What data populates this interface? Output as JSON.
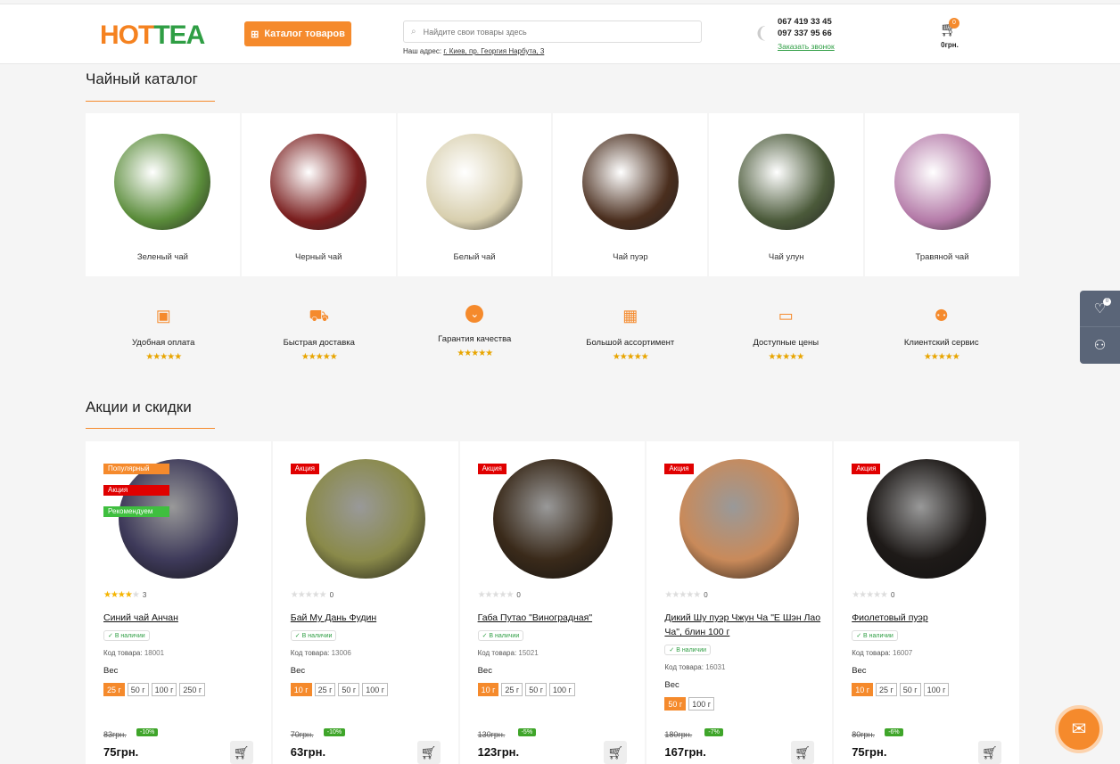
{
  "header": {
    "logo_hot": "HOT",
    "logo_tea": "TEA",
    "catalog_button": "Каталог товаров",
    "search_placeholder": "Найдите свои товары здесь",
    "address_label": "Наш адрес:",
    "address_value": "г. Киев, пр. Георгия Нарбута, 3",
    "phone1": "067 419 33 45",
    "phone2": "097 337 95 66",
    "callback": "Заказать звонок",
    "cart_count": "0",
    "cart_sum": "0грн."
  },
  "catalog": {
    "title": "Чайный каталог",
    "items": [
      {
        "label": "Зеленый чай",
        "color": "#5a8c3a"
      },
      {
        "label": "Черный чай",
        "color": "#7a1f1f"
      },
      {
        "label": "Белый чай",
        "color": "#d8cfae"
      },
      {
        "label": "Чай пуэр",
        "color": "#4a2e1e"
      },
      {
        "label": "Чай улун",
        "color": "#4b5a3a"
      },
      {
        "label": "Травяной чай",
        "color": "#b47aa8"
      }
    ]
  },
  "features": [
    {
      "label": "Удобная оплата",
      "icon": "id-card-icon",
      "stars": "★★★★★"
    },
    {
      "label": "Быстрая доставка",
      "icon": "truck-icon",
      "stars": "★★★★★"
    },
    {
      "label": "Гарантия качества",
      "icon": "check-circle-icon",
      "stars": "★★★★★"
    },
    {
      "label": "Большой ассортимент",
      "icon": "grid-icon",
      "stars": "★★★★★"
    },
    {
      "label": "Доступные цены",
      "icon": "money-icon",
      "stars": "★★★★★"
    },
    {
      "label": "Клиентский сервис",
      "icon": "users-icon",
      "stars": "★★★★★"
    }
  ],
  "promo": {
    "title": "Акции и скидки",
    "weight_label": "Вес",
    "code_label": "Код товара:",
    "avail_label": "В наличии",
    "products": [
      {
        "name": "Синий чай Анчан",
        "badges": [
          "Популярный",
          "Акция",
          "Рекомендуем"
        ],
        "stars_on": "★★★★",
        "stars_off": "★",
        "reviews": "3",
        "code": "18001",
        "weights": [
          "25 г",
          "50 г",
          "100 г",
          "250 г"
        ],
        "old_price": "83грн.",
        "discount": "-10%",
        "price": "75грн.",
        "color": "#3e3a5a"
      },
      {
        "name": "Бай Му Дань Фудин",
        "badges": [
          "Акция"
        ],
        "stars_on": "",
        "stars_off": "★★★★★",
        "reviews": "0",
        "code": "13006",
        "weights": [
          "10 г",
          "25 г",
          "50 г",
          "100 г"
        ],
        "old_price": "70грн.",
        "discount": "-10%",
        "price": "63грн.",
        "color": "#8a8a4a"
      },
      {
        "name": "Габа Путао \"Виноградная\"",
        "badges": [
          "Акция"
        ],
        "stars_on": "",
        "stars_off": "★★★★★",
        "reviews": "0",
        "code": "15021",
        "weights": [
          "10 г",
          "25 г",
          "50 г",
          "100 г"
        ],
        "old_price": "130грн.",
        "discount": "-5%",
        "price": "123грн.",
        "color": "#3a2a1a"
      },
      {
        "name": "Дикий Шу пуэр Чжун Ча \"Е Шэн Лао Ча\", блин 100 г",
        "badges": [
          "Акция"
        ],
        "stars_on": "",
        "stars_off": "★★★★★",
        "reviews": "0",
        "code": "16031",
        "weights": [
          "50 г",
          "100 г"
        ],
        "old_price": "180грн.",
        "discount": "-7%",
        "price": "167грн.",
        "color": "#c98a5a"
      },
      {
        "name": "Фиолетовый пуэр",
        "badges": [
          "Акция"
        ],
        "stars_on": "",
        "stars_off": "★★★★★",
        "reviews": "0",
        "code": "16007",
        "weights": [
          "10 г",
          "25 г",
          "50 г",
          "100 г"
        ],
        "old_price": "80грн.",
        "discount": "-6%",
        "price": "75грн.",
        "color": "#1e1a18"
      }
    ]
  },
  "side": {
    "wish_count": "0"
  }
}
